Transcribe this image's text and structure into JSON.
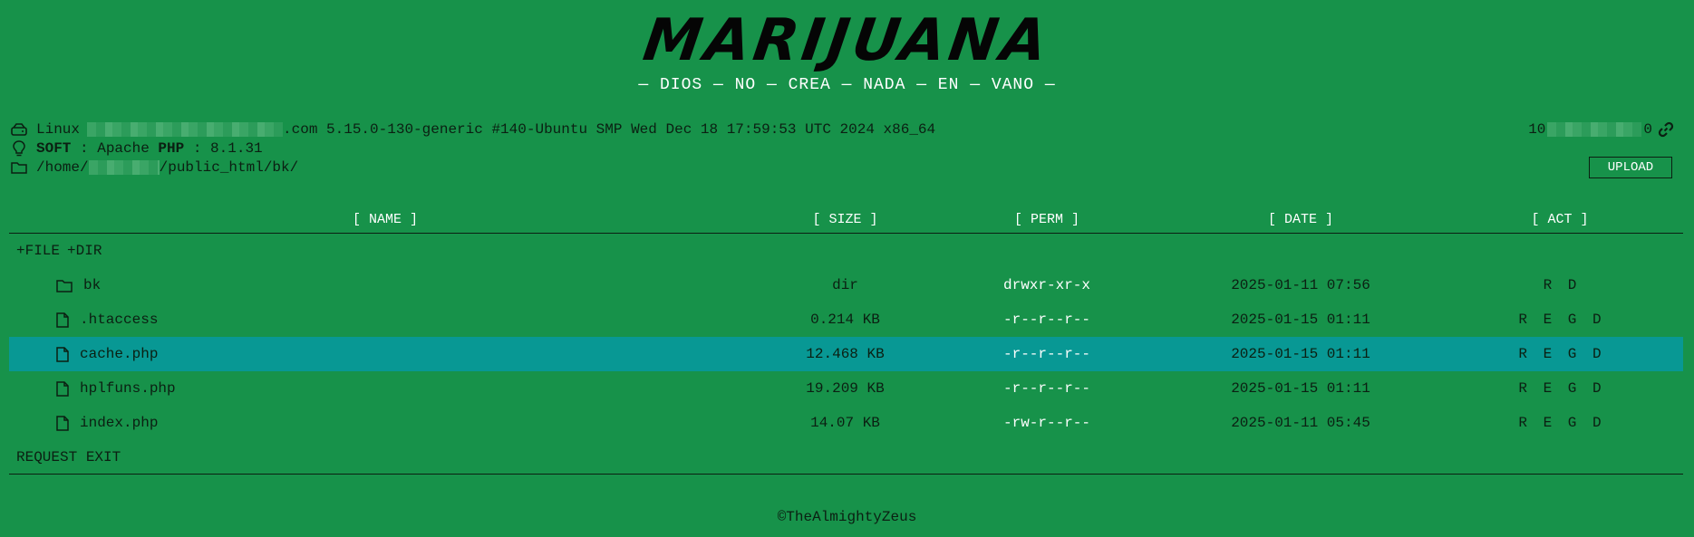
{
  "header": {
    "logo": "MARIJUANA",
    "tagline": "— DIOS — NO — CREA — NADA — EN — VANO —"
  },
  "system": {
    "uname_prefix": "Linux",
    "uname_suffix": ".com 5.15.0-130-generic #140-Ubuntu SMP Wed Dec 18 17:59:53 UTC 2024 x86_64",
    "soft_label": "SOFT",
    "soft_value": " : Apache ",
    "php_label": "PHP",
    "php_value": " : 8.1.31",
    "path_prefix": "/home/",
    "path_suffix": "/public_html/bk/",
    "ip_prefix": "10",
    "ip_suffix": "0"
  },
  "toolbar": {
    "upload_label": "UPLOAD"
  },
  "table": {
    "columns": [
      "[ NAME ]",
      "[ SIZE ]",
      "[ PERM ]",
      "[ DATE ]",
      "[ ACT ]"
    ],
    "new_file": "+FILE",
    "new_dir": "+DIR",
    "rows": [
      {
        "name": "bk",
        "size": "dir",
        "perm": "drwxr-xr-x",
        "date": "2025-01-11 07:56",
        "act": "R D"
      },
      {
        "name": ".htaccess",
        "size": "0.214 KB",
        "perm": "-r--r--r--",
        "date": "2025-01-15 01:11",
        "act": "R E G D"
      },
      {
        "name": "cache.php",
        "size": "12.468 KB",
        "perm": "-r--r--r--",
        "date": "2025-01-15 01:11",
        "act": "R E G D"
      },
      {
        "name": "hplfuns.php",
        "size": "19.209 KB",
        "perm": "-r--r--r--",
        "date": "2025-01-15 01:11",
        "act": "R E G D"
      },
      {
        "name": "index.php",
        "size": "14.07 KB",
        "perm": "-rw-r--r--",
        "date": "2025-01-11 05:45",
        "act": "R E G D"
      }
    ],
    "exit_label": "REQUEST EXIT"
  },
  "footer": {
    "copyright": "©TheAlmightyZeus"
  },
  "icons": [
    "hdd-icon",
    "bulb-icon",
    "folder-icon",
    "link-icon",
    "file-icon"
  ],
  "colors": {
    "background": "#17924a",
    "highlight_row": "#089894",
    "text": "#0b1f12",
    "light_text": "#ffffff"
  }
}
